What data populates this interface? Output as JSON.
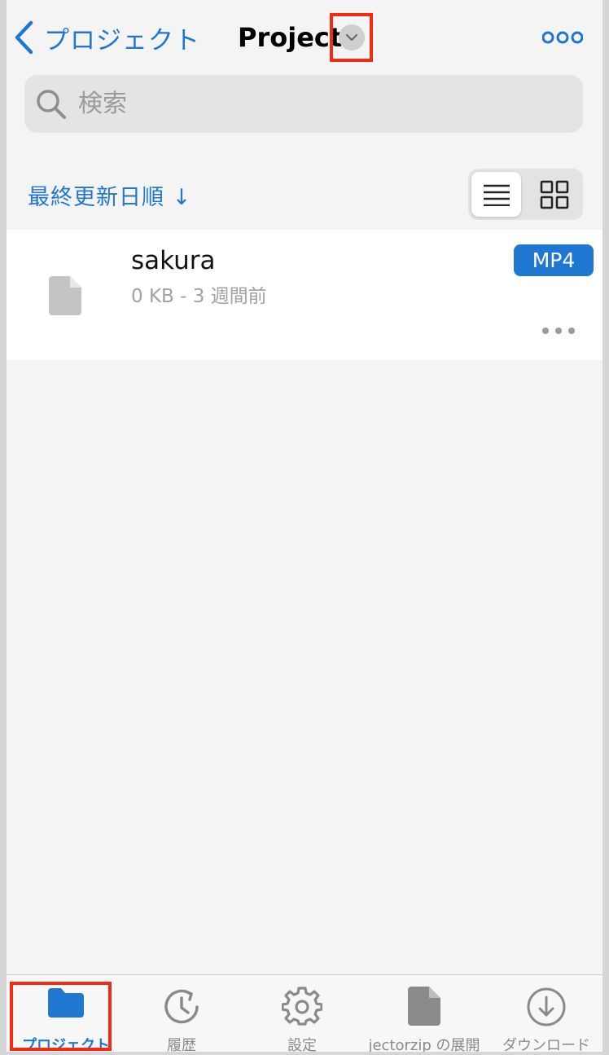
{
  "navbar": {
    "back_label": "プロジェクト",
    "title": "Project"
  },
  "search": {
    "placeholder": "検索"
  },
  "sort": {
    "label": "最終更新日順 ↓"
  },
  "view_toggle": {
    "selected": "list"
  },
  "files": [
    {
      "name": "sakura",
      "meta": "0 KB - 3 週間前",
      "badge": "MP4"
    }
  ],
  "tabbar": {
    "active": "projects",
    "tabs": [
      {
        "id": "projects",
        "label": "プロジェクト",
        "icon": "folder-icon"
      },
      {
        "id": "history",
        "label": "履歴",
        "icon": "history-icon"
      },
      {
        "id": "settings",
        "label": "設定",
        "icon": "gear-icon"
      },
      {
        "id": "jectorzip",
        "label": "jectorzip の展開",
        "icon": "document-icon"
      },
      {
        "id": "download",
        "label": "ダウンロード",
        "icon": "download-icon"
      }
    ]
  },
  "colors": {
    "accent": "#1f77d2",
    "highlight": "#f52a12",
    "background": "#f4f4f4"
  }
}
